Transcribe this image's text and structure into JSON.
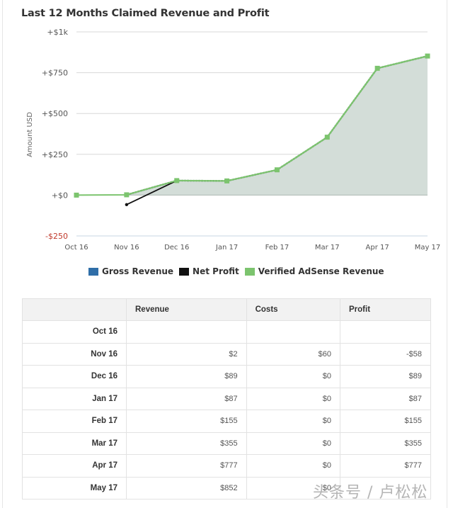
{
  "title": "Last 12 Months Claimed Revenue and Profit",
  "colors": {
    "gross_revenue": "#2f6ea8",
    "net_profit": "#111111",
    "verified_adsense": "#7cc46e",
    "area_fill": "#d3ddd8",
    "negative_tick": "#c0392b",
    "grid": "#d8d8d8"
  },
  "chart_data": {
    "type": "area",
    "title": "Last 12 Months Claimed Revenue and Profit",
    "xlabel": "",
    "ylabel": "Amount USD",
    "categories": [
      "Oct 16",
      "Nov 16",
      "Dec 16",
      "Jan 17",
      "Feb 17",
      "Mar 17",
      "Apr 17",
      "May 17"
    ],
    "y_ticks": [
      -250,
      0,
      250,
      500,
      750,
      1000
    ],
    "y_tick_labels": [
      "-$250",
      "+$0",
      "+$250",
      "+$500",
      "+$750",
      "+$1k"
    ],
    "ylim": [
      -250,
      1000
    ],
    "grid": true,
    "legend_position": "bottom",
    "series": [
      {
        "name": "Gross Revenue",
        "values": [
          null,
          2,
          89,
          87,
          155,
          355,
          777,
          852
        ]
      },
      {
        "name": "Net Profit",
        "values": [
          null,
          -58,
          89,
          null,
          null,
          null,
          null,
          null
        ]
      },
      {
        "name": "Verified AdSense Revenue",
        "values": [
          0,
          2,
          89,
          87,
          155,
          355,
          777,
          852
        ]
      }
    ]
  },
  "legend": [
    {
      "label": "Gross Revenue",
      "color_key": "gross_revenue"
    },
    {
      "label": "Net Profit",
      "color_key": "net_profit"
    },
    {
      "label": "Verified AdSense Revenue",
      "color_key": "verified_adsense"
    }
  ],
  "table": {
    "headers": [
      "",
      "Revenue",
      "Costs",
      "Profit"
    ],
    "rows": [
      {
        "month": "Oct 16",
        "revenue": "",
        "costs": "",
        "profit": ""
      },
      {
        "month": "Nov 16",
        "revenue": "$2",
        "costs": "$60",
        "profit": "-$58"
      },
      {
        "month": "Dec 16",
        "revenue": "$89",
        "costs": "$0",
        "profit": "$89"
      },
      {
        "month": "Jan 17",
        "revenue": "$87",
        "costs": "$0",
        "profit": "$87"
      },
      {
        "month": "Feb 17",
        "revenue": "$155",
        "costs": "$0",
        "profit": "$155"
      },
      {
        "month": "Mar 17",
        "revenue": "$355",
        "costs": "$0",
        "profit": "$355"
      },
      {
        "month": "Apr 17",
        "revenue": "$777",
        "costs": "$0",
        "profit": "$777"
      },
      {
        "month": "May 17",
        "revenue": "$852",
        "costs": "$0",
        "profit": ""
      }
    ]
  },
  "watermark": "头条号 / 卢松松"
}
